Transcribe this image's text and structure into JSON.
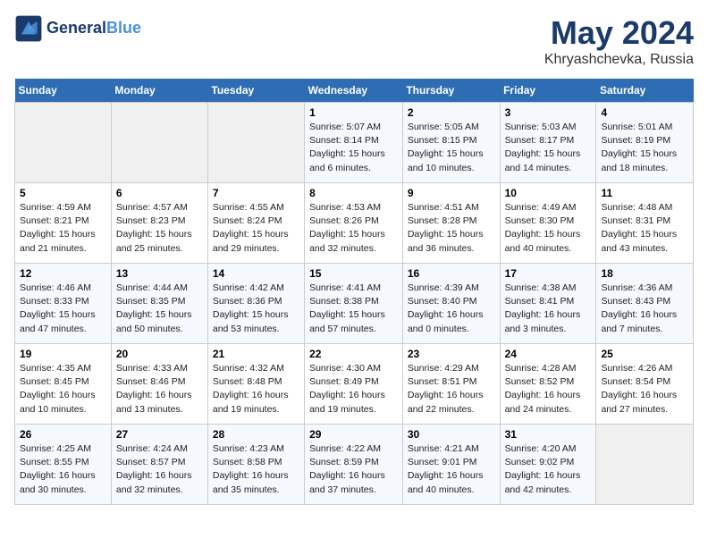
{
  "header": {
    "logo_line1": "General",
    "logo_line2": "Blue",
    "month": "May 2024",
    "location": "Khryashchevka, Russia"
  },
  "days_of_week": [
    "Sunday",
    "Monday",
    "Tuesday",
    "Wednesday",
    "Thursday",
    "Friday",
    "Saturday"
  ],
  "weeks": [
    [
      {
        "day": "",
        "info": ""
      },
      {
        "day": "",
        "info": ""
      },
      {
        "day": "",
        "info": ""
      },
      {
        "day": "1",
        "info": "Sunrise: 5:07 AM\nSunset: 8:14 PM\nDaylight: 15 hours\nand 6 minutes."
      },
      {
        "day": "2",
        "info": "Sunrise: 5:05 AM\nSunset: 8:15 PM\nDaylight: 15 hours\nand 10 minutes."
      },
      {
        "day": "3",
        "info": "Sunrise: 5:03 AM\nSunset: 8:17 PM\nDaylight: 15 hours\nand 14 minutes."
      },
      {
        "day": "4",
        "info": "Sunrise: 5:01 AM\nSunset: 8:19 PM\nDaylight: 15 hours\nand 18 minutes."
      }
    ],
    [
      {
        "day": "5",
        "info": "Sunrise: 4:59 AM\nSunset: 8:21 PM\nDaylight: 15 hours\nand 21 minutes."
      },
      {
        "day": "6",
        "info": "Sunrise: 4:57 AM\nSunset: 8:23 PM\nDaylight: 15 hours\nand 25 minutes."
      },
      {
        "day": "7",
        "info": "Sunrise: 4:55 AM\nSunset: 8:24 PM\nDaylight: 15 hours\nand 29 minutes."
      },
      {
        "day": "8",
        "info": "Sunrise: 4:53 AM\nSunset: 8:26 PM\nDaylight: 15 hours\nand 32 minutes."
      },
      {
        "day": "9",
        "info": "Sunrise: 4:51 AM\nSunset: 8:28 PM\nDaylight: 15 hours\nand 36 minutes."
      },
      {
        "day": "10",
        "info": "Sunrise: 4:49 AM\nSunset: 8:30 PM\nDaylight: 15 hours\nand 40 minutes."
      },
      {
        "day": "11",
        "info": "Sunrise: 4:48 AM\nSunset: 8:31 PM\nDaylight: 15 hours\nand 43 minutes."
      }
    ],
    [
      {
        "day": "12",
        "info": "Sunrise: 4:46 AM\nSunset: 8:33 PM\nDaylight: 15 hours\nand 47 minutes."
      },
      {
        "day": "13",
        "info": "Sunrise: 4:44 AM\nSunset: 8:35 PM\nDaylight: 15 hours\nand 50 minutes."
      },
      {
        "day": "14",
        "info": "Sunrise: 4:42 AM\nSunset: 8:36 PM\nDaylight: 15 hours\nand 53 minutes."
      },
      {
        "day": "15",
        "info": "Sunrise: 4:41 AM\nSunset: 8:38 PM\nDaylight: 15 hours\nand 57 minutes."
      },
      {
        "day": "16",
        "info": "Sunrise: 4:39 AM\nSunset: 8:40 PM\nDaylight: 16 hours\nand 0 minutes."
      },
      {
        "day": "17",
        "info": "Sunrise: 4:38 AM\nSunset: 8:41 PM\nDaylight: 16 hours\nand 3 minutes."
      },
      {
        "day": "18",
        "info": "Sunrise: 4:36 AM\nSunset: 8:43 PM\nDaylight: 16 hours\nand 7 minutes."
      }
    ],
    [
      {
        "day": "19",
        "info": "Sunrise: 4:35 AM\nSunset: 8:45 PM\nDaylight: 16 hours\nand 10 minutes."
      },
      {
        "day": "20",
        "info": "Sunrise: 4:33 AM\nSunset: 8:46 PM\nDaylight: 16 hours\nand 13 minutes."
      },
      {
        "day": "21",
        "info": "Sunrise: 4:32 AM\nSunset: 8:48 PM\nDaylight: 16 hours\nand 19 minutes."
      },
      {
        "day": "22",
        "info": "Sunrise: 4:30 AM\nSunset: 8:49 PM\nDaylight: 16 hours\nand 19 minutes."
      },
      {
        "day": "23",
        "info": "Sunrise: 4:29 AM\nSunset: 8:51 PM\nDaylight: 16 hours\nand 22 minutes."
      },
      {
        "day": "24",
        "info": "Sunrise: 4:28 AM\nSunset: 8:52 PM\nDaylight: 16 hours\nand 24 minutes."
      },
      {
        "day": "25",
        "info": "Sunrise: 4:26 AM\nSunset: 8:54 PM\nDaylight: 16 hours\nand 27 minutes."
      }
    ],
    [
      {
        "day": "26",
        "info": "Sunrise: 4:25 AM\nSunset: 8:55 PM\nDaylight: 16 hours\nand 30 minutes."
      },
      {
        "day": "27",
        "info": "Sunrise: 4:24 AM\nSunset: 8:57 PM\nDaylight: 16 hours\nand 32 minutes."
      },
      {
        "day": "28",
        "info": "Sunrise: 4:23 AM\nSunset: 8:58 PM\nDaylight: 16 hours\nand 35 minutes."
      },
      {
        "day": "29",
        "info": "Sunrise: 4:22 AM\nSunset: 8:59 PM\nDaylight: 16 hours\nand 37 minutes."
      },
      {
        "day": "30",
        "info": "Sunrise: 4:21 AM\nSunset: 9:01 PM\nDaylight: 16 hours\nand 40 minutes."
      },
      {
        "day": "31",
        "info": "Sunrise: 4:20 AM\nSunset: 9:02 PM\nDaylight: 16 hours\nand 42 minutes."
      },
      {
        "day": "",
        "info": ""
      }
    ]
  ]
}
